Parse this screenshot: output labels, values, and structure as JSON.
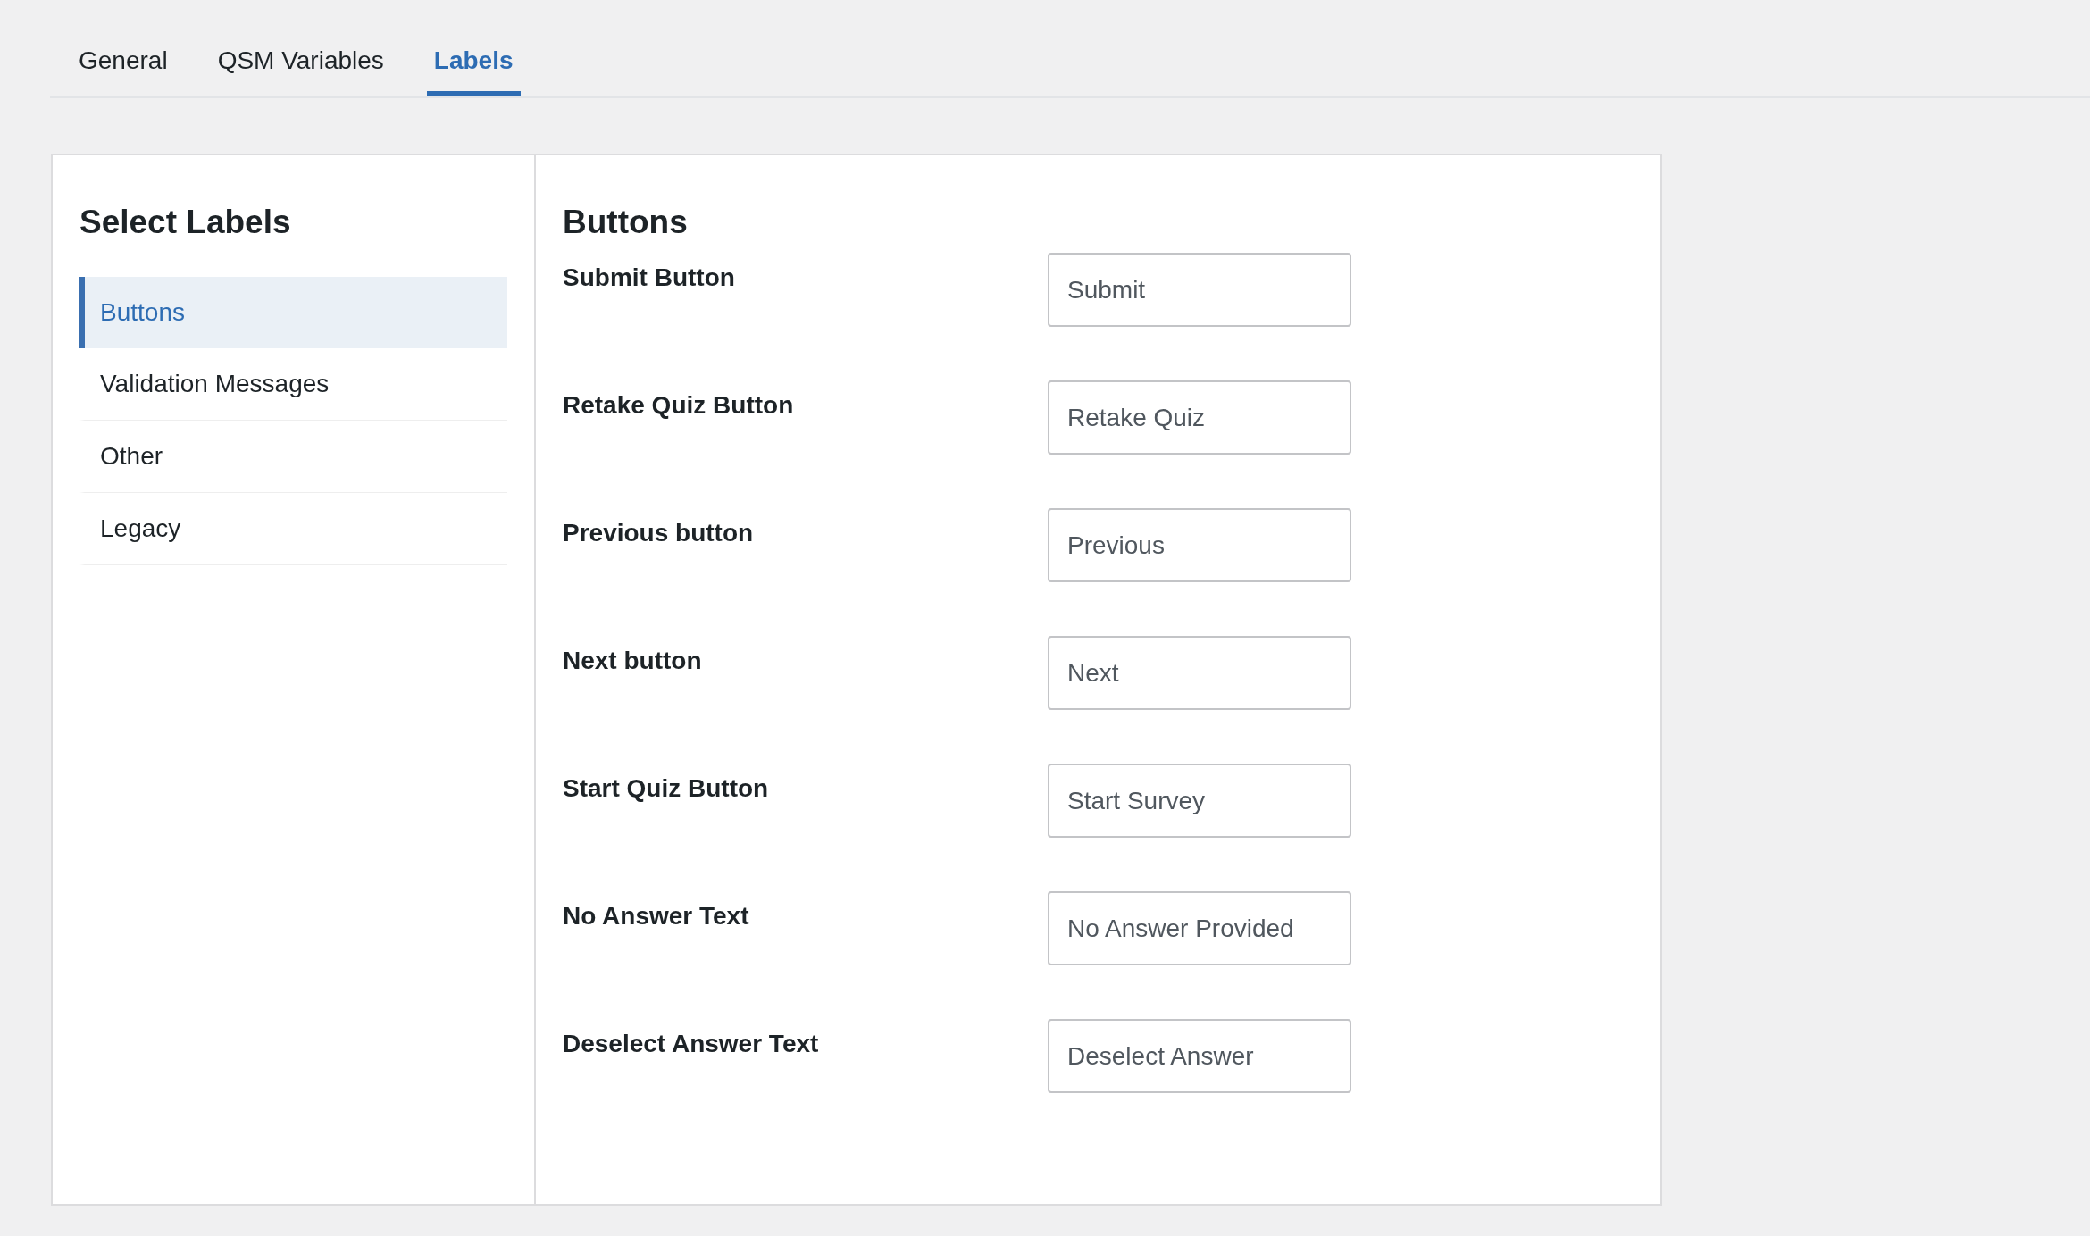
{
  "tabs": [
    {
      "label": "General",
      "selected": false
    },
    {
      "label": "QSM Variables",
      "selected": false
    },
    {
      "label": "Labels",
      "selected": true
    }
  ],
  "sidebar": {
    "title": "Select Labels",
    "items": [
      {
        "label": "Buttons",
        "selected": true
      },
      {
        "label": "Validation Messages",
        "selected": false
      },
      {
        "label": "Other",
        "selected": false
      },
      {
        "label": "Legacy",
        "selected": false
      }
    ]
  },
  "section": {
    "title": "Buttons",
    "fields": [
      {
        "label": "Submit Button",
        "value": "Submit"
      },
      {
        "label": "Retake Quiz Button",
        "value": "Retake Quiz"
      },
      {
        "label": "Previous button",
        "value": "Previous"
      },
      {
        "label": "Next button",
        "value": "Next"
      },
      {
        "label": "Start Quiz Button",
        "value": "Start Survey"
      },
      {
        "label": "No Answer Text",
        "value": "No Answer Provided"
      },
      {
        "label": "Deselect Answer Text",
        "value": "Deselect Answer"
      }
    ]
  }
}
